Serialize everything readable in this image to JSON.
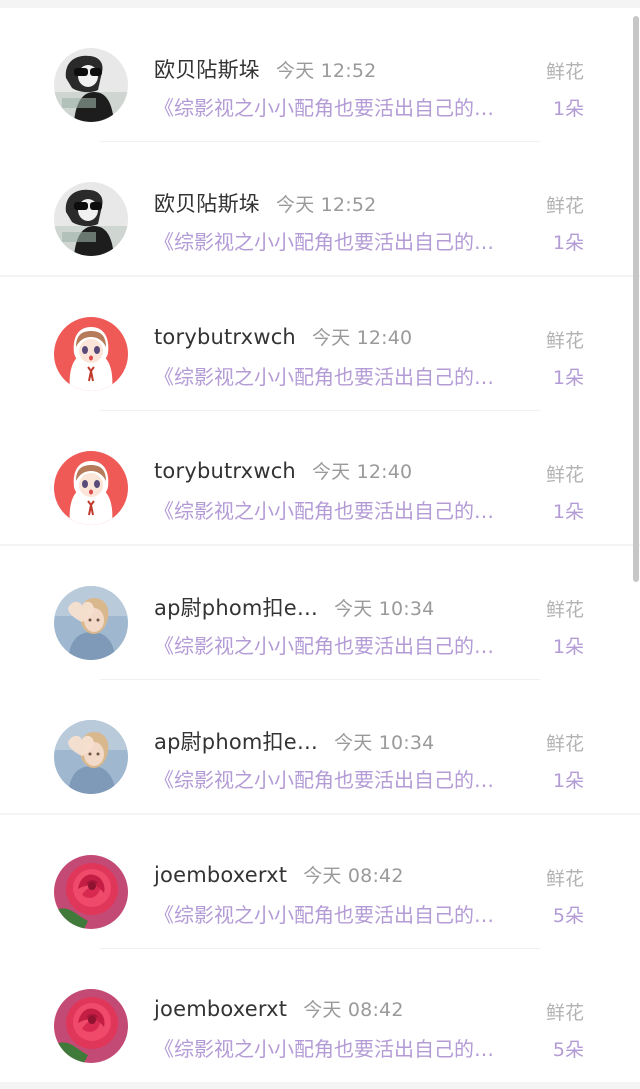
{
  "items": [
    {
      "name": "欧贝阽斯垛",
      "time": "今天 12:52",
      "gift_type": "鲜花",
      "book": "《综影视之小小配角也要活出自己的…",
      "count": "1朵",
      "avatar": "bw-girl-sunglasses"
    },
    {
      "name": "欧贝阽斯垛",
      "time": "今天 12:52",
      "gift_type": "鲜花",
      "book": "《综影视之小小配角也要活出自己的…",
      "count": "1朵",
      "avatar": "bw-girl-sunglasses"
    },
    {
      "name": "torybutrxwch",
      "time": "今天 12:40",
      "gift_type": "鲜花",
      "book": "《综影视之小小配角也要活出自己的…",
      "count": "1朵",
      "avatar": "anime-girl-red"
    },
    {
      "name": "torybutrxwch",
      "time": "今天 12:40",
      "gift_type": "鲜花",
      "book": "《综影视之小小配角也要活出自己的…",
      "count": "1朵",
      "avatar": "anime-girl-red"
    },
    {
      "name": "ap尉phom扣e…",
      "time": "今天 10:34",
      "gift_type": "鲜花",
      "book": "《综影视之小小配角也要活出自己的…",
      "count": "1朵",
      "avatar": "child-heart-hands"
    },
    {
      "name": "ap尉phom扣e…",
      "time": "今天 10:34",
      "gift_type": "鲜花",
      "book": "《综影视之小小配角也要活出自己的…",
      "count": "1朵",
      "avatar": "child-heart-hands"
    },
    {
      "name": "joemboxerxt",
      "time": "今天 08:42",
      "gift_type": "鲜花",
      "book": "《综影视之小小配角也要活出自己的…",
      "count": "5朵",
      "avatar": "red-rose"
    },
    {
      "name": "joemboxerxt",
      "time": "今天 08:42",
      "gift_type": "鲜花",
      "book": "《综影视之小小配角也要活出自己的…",
      "count": "5朵",
      "avatar": "red-rose"
    }
  ],
  "colors": {
    "accent_purple": "#b39bd6",
    "name_text": "#333333",
    "muted_text": "#9a9a9a",
    "background": "#f4f4f4"
  }
}
